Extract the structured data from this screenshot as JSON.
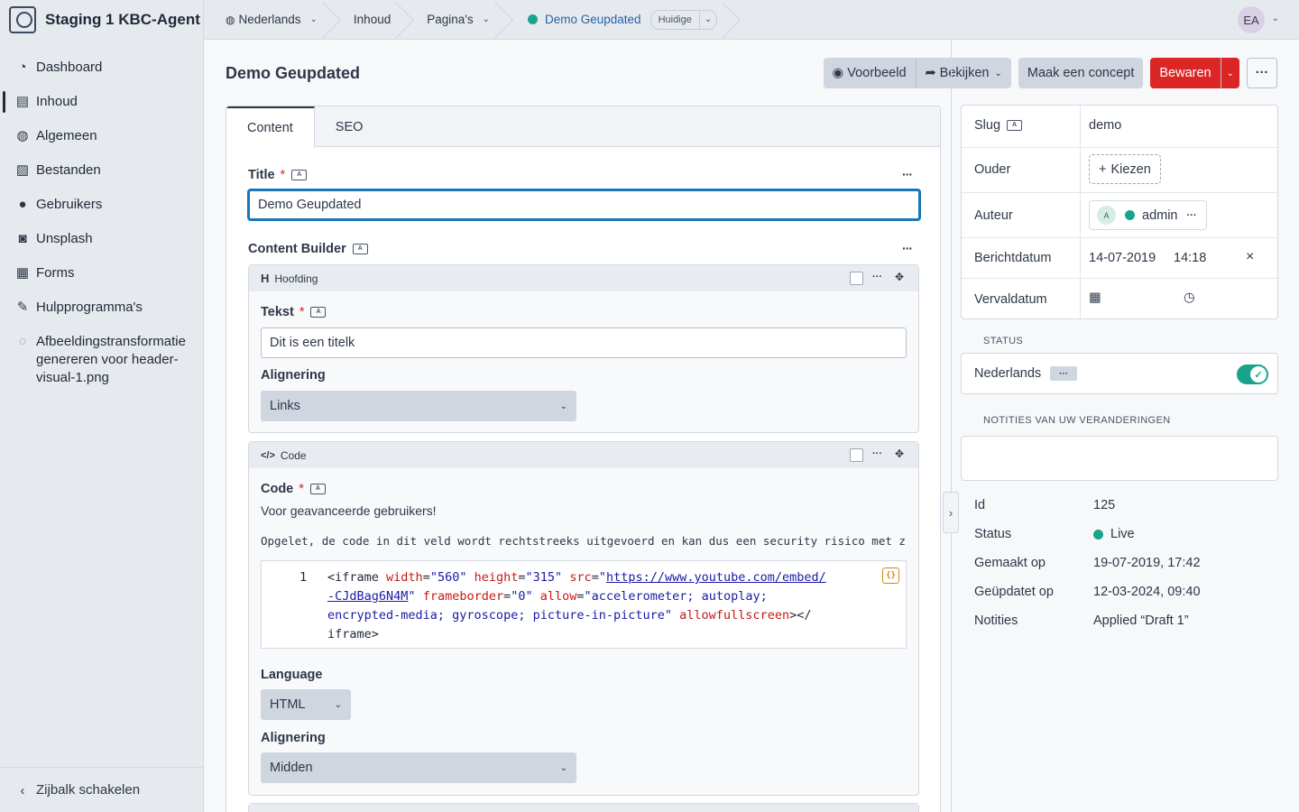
{
  "app": {
    "title": "Staging 1 KBC-Agent"
  },
  "sidebar": {
    "items": [
      {
        "label": "Dashboard",
        "icon": "dashboard-icon"
      },
      {
        "label": "Inhoud",
        "icon": "content-icon",
        "active": true
      },
      {
        "label": "Algemeen",
        "icon": "globe-icon"
      },
      {
        "label": "Bestanden",
        "icon": "image-icon"
      },
      {
        "label": "Gebruikers",
        "icon": "users-icon"
      },
      {
        "label": "Unsplash",
        "icon": "camera-icon"
      },
      {
        "label": "Forms",
        "icon": "form-icon"
      },
      {
        "label": "Hulpprogramma's",
        "icon": "wrench-icon"
      },
      {
        "label": "Afbeeldingstransformatie genereren voor header-visual-1.png",
        "icon": "spinner-icon"
      }
    ],
    "toggle_label": "Zijbalk schakelen"
  },
  "breadcrumb": {
    "site": "Nederlands",
    "section": "Inhoud",
    "collection": "Pagina's",
    "entry": "Demo Geupdated",
    "version": "Huidige"
  },
  "user": {
    "initials": "EA"
  },
  "page": {
    "title": "Demo Geupdated"
  },
  "toolbar": {
    "preview": "Voorbeeld",
    "view": "Bekijken",
    "draft": "Maak een concept",
    "save": "Bewaren"
  },
  "tabs": [
    "Content",
    "SEO"
  ],
  "form": {
    "title_label": "Title",
    "title_value": "Demo Geupdated",
    "builder_label": "Content Builder",
    "heading_block": {
      "name": "Hoofding",
      "text_label": "Tekst",
      "text_value": "Dit is een titelk",
      "align_label": "Alignering",
      "align_value": "Links"
    },
    "code_block": {
      "name": "Code",
      "code_label": "Code",
      "description": "Voor geavanceerde gebruikers!",
      "warning": "Opgelet, de code in dit veld wordt rechtstreeks uitgevoerd en kan dus een security risico met zich meebrengen.",
      "line_number": "1",
      "code_parts": {
        "open": "<iframe",
        "a_width": "width",
        "v_width": "\"560\"",
        "a_height": "height",
        "v_height": "\"315\"",
        "a_src": "src",
        "v_src_url1": "https://www.youtube.com/embed/",
        "v_src_url2": "-CJdBag6N4M",
        "a_frame": "frameborder",
        "v_frame": "\"0\"",
        "a_allow": "allow",
        "v_allow1": "\"accelerometer; autoplay;",
        "v_allow2": "encrypted-media; gyroscope; picture-in-picture\"",
        "a_full": "allowfullscreen",
        "close1": "></",
        "close2": "iframe>"
      },
      "lang_label": "Language",
      "lang_value": "HTML",
      "align_label": "Alignering",
      "align_value": "Midden"
    }
  },
  "meta": {
    "slug_label": "Slug",
    "slug_value": "demo",
    "parent_label": "Ouder",
    "parent_button": "Kiezen",
    "author_label": "Auteur",
    "author_initial": "A",
    "author_value": "admin",
    "date_label": "Berichtdatum",
    "date_value": "14-07-2019",
    "time_value": "14:18",
    "expiry_label": "Vervaldatum"
  },
  "status": {
    "section_label": "STATUS",
    "site": "Nederlands",
    "published": true
  },
  "notes": {
    "section_label": "NOTITIES VAN UW VERANDERINGEN"
  },
  "info": [
    {
      "key": "Id",
      "value": "125"
    },
    {
      "key": "Status",
      "value": "Live"
    },
    {
      "key": "Gemaakt op",
      "value": "19-07-2019, 17:42"
    },
    {
      "key": "Geüpdatet op",
      "value": "12-03-2024, 09:40"
    },
    {
      "key": "Notities",
      "value": "Applied “Draft 1”"
    }
  ],
  "colors": {
    "accent": "#19a38c",
    "save": "#dc2626",
    "focus": "#1976b8"
  }
}
